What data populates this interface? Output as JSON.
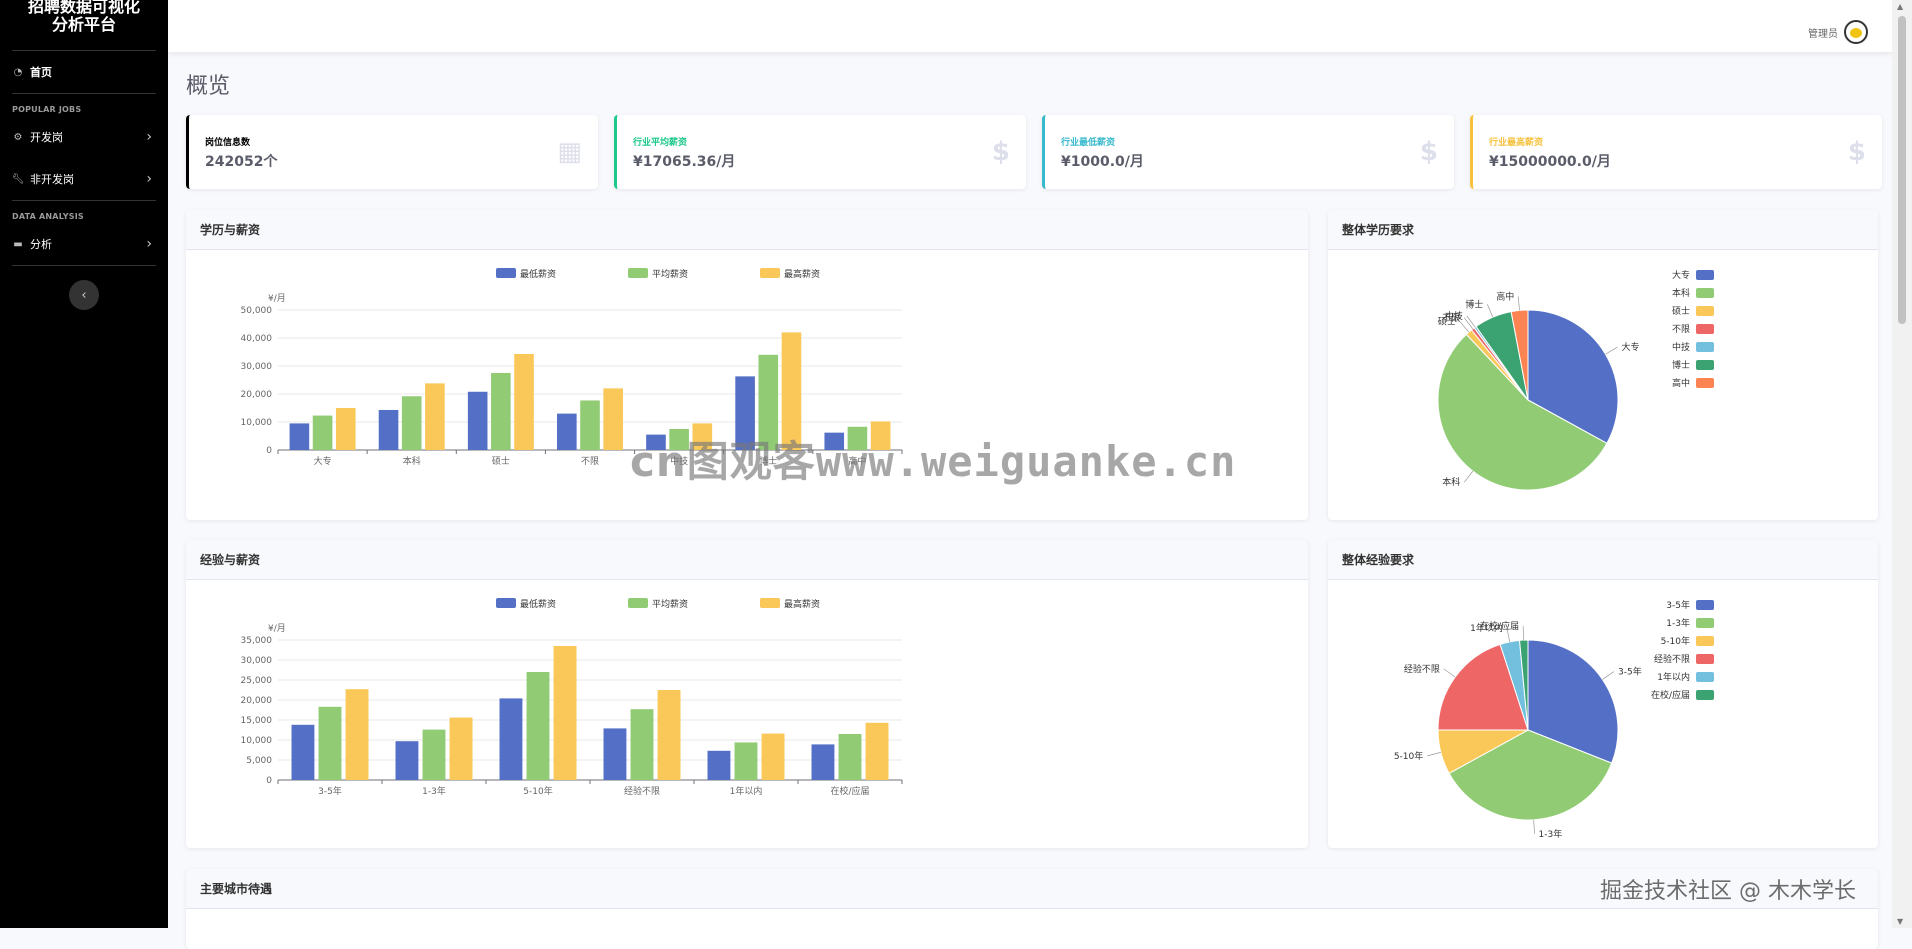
{
  "app": {
    "brand_line1": "招聘数据可视化",
    "brand_line2": "分析平台",
    "page_title": "概览"
  },
  "sidebar": {
    "home": "首页",
    "section1": "POPULAR JOBS",
    "dev": "开发岗",
    "nondev": "非开发岗",
    "section2": "DATA ANALYSIS",
    "analysis": "分析"
  },
  "topbar": {
    "user_name": "管理员"
  },
  "stats": [
    {
      "label": "岗位信息数",
      "value": "242052个",
      "color": "#000000",
      "icon": "table-icon"
    },
    {
      "label": "行业平均薪资",
      "value": "¥17065.36/月",
      "color": "#1cc88a",
      "icon": "dollar-icon"
    },
    {
      "label": "行业最低薪资",
      "value": "¥1000.0/月",
      "color": "#36b9cc",
      "icon": "dollar-icon"
    },
    {
      "label": "行业最高薪资",
      "value": "¥15000000.0/月",
      "color": "#f6c23e",
      "icon": "dollar-icon"
    }
  ],
  "panels": {
    "edu_salary": "学历与薪资",
    "edu_pie": "整体学历要求",
    "exp_salary": "经验与薪资",
    "exp_pie": "整体经验要求",
    "city": "主要城市待遇"
  },
  "watermark": {
    "center": "www.weiguanke.cn",
    "center_prefix": "cn图观客",
    "corner": "掘金技术社区 @ 木木学长"
  },
  "chart_data": [
    {
      "type": "bar",
      "id": "edu_salary",
      "ylabel": "¥/月",
      "categories": [
        "大专",
        "本科",
        "硕士",
        "不限",
        "中技",
        "博士",
        "高中"
      ],
      "series": [
        {
          "name": "最低薪资",
          "color": "#5470c6",
          "values": [
            9500,
            14300,
            20800,
            13000,
            5500,
            26300,
            6200
          ]
        },
        {
          "name": "平均薪资",
          "color": "#91cc75",
          "values": [
            12300,
            19200,
            27500,
            17700,
            7500,
            34000,
            8300
          ]
        },
        {
          "name": "最高薪资",
          "color": "#fac858",
          "values": [
            15000,
            23800,
            34300,
            22000,
            9500,
            42000,
            10200
          ]
        }
      ],
      "ylim": [
        0,
        50000
      ],
      "yticks": [
        "0",
        "10,000",
        "20,000",
        "30,000",
        "40,000",
        "50,000"
      ],
      "legend": "top-center"
    },
    {
      "type": "pie",
      "id": "edu_pie",
      "labels": [
        "大专",
        "本科",
        "硕士",
        "不限",
        "中技",
        "博士",
        "高中"
      ],
      "colors": [
        "#5470c6",
        "#91cc75",
        "#fac858",
        "#ee6666",
        "#73c0de",
        "#3ba272",
        "#fc8452"
      ],
      "values": [
        33,
        55,
        1.2,
        0.6,
        0.4,
        6.8,
        3
      ],
      "legend": "right"
    },
    {
      "type": "bar",
      "id": "exp_salary",
      "ylabel": "¥/月",
      "categories": [
        "3-5年",
        "1-3年",
        "5-10年",
        "经验不限",
        "1年以内",
        "在校/应届"
      ],
      "series": [
        {
          "name": "最低薪资",
          "color": "#5470c6",
          "values": [
            13800,
            9700,
            20400,
            12900,
            7300,
            8900
          ]
        },
        {
          "name": "平均薪资",
          "color": "#91cc75",
          "values": [
            18300,
            12600,
            27000,
            17700,
            9400,
            11500
          ]
        },
        {
          "name": "最高薪资",
          "color": "#fac858",
          "values": [
            22700,
            15600,
            33500,
            22500,
            11600,
            14300
          ]
        }
      ],
      "ylim": [
        0,
        35000
      ],
      "yticks": [
        "0",
        "5,000",
        "10,000",
        "15,000",
        "20,000",
        "25,000",
        "30,000",
        "35,000"
      ],
      "legend": "top-center"
    },
    {
      "type": "pie",
      "id": "exp_pie",
      "labels": [
        "3-5年",
        "1-3年",
        "5-10年",
        "经验不限",
        "1年以内",
        "在校/应届"
      ],
      "colors": [
        "#5470c6",
        "#91cc75",
        "#fac858",
        "#ee6666",
        "#73c0de",
        "#3ba272"
      ],
      "values": [
        31,
        36,
        8,
        20,
        3.5,
        1.5
      ],
      "legend": "right"
    }
  ]
}
